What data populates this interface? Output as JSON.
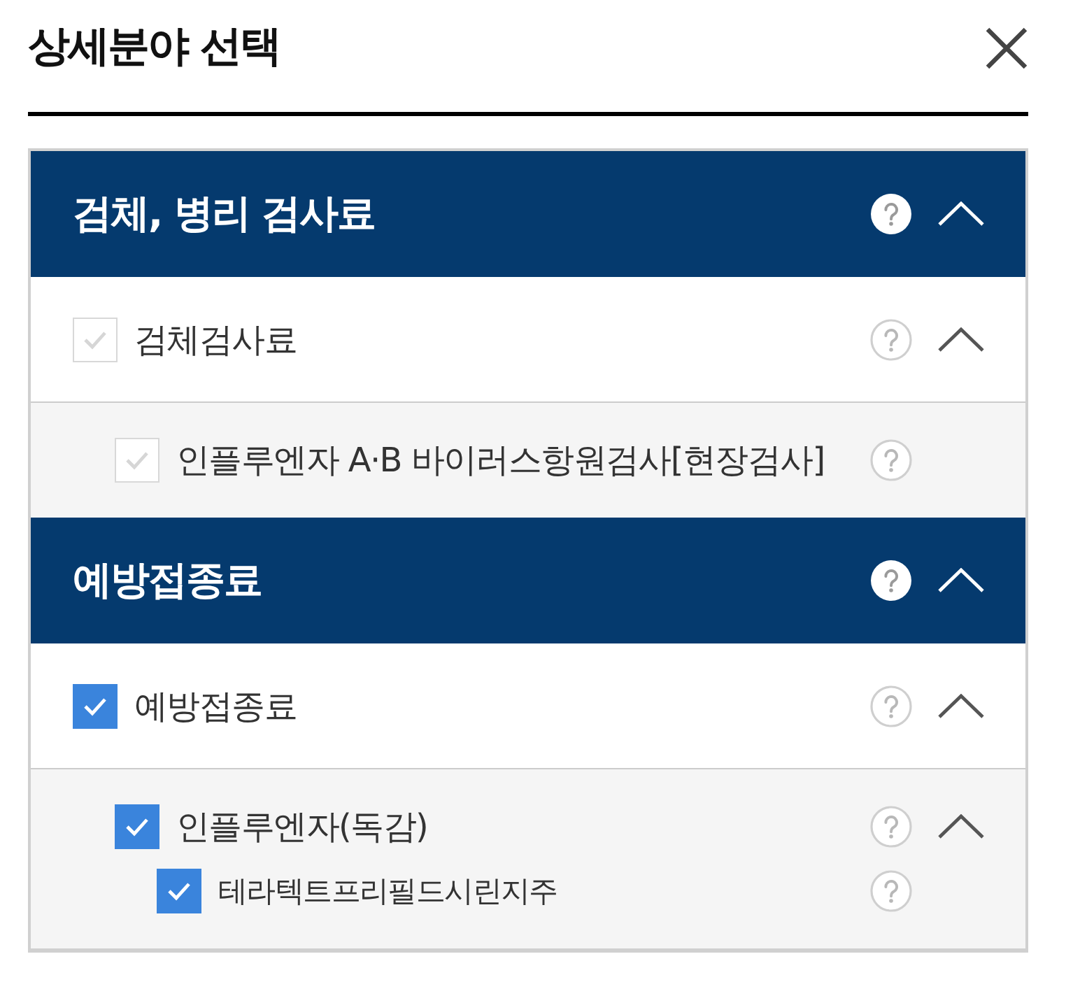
{
  "title": "상세분야 선택",
  "sections": [
    {
      "title": "검체, 병리 검사료",
      "expanded": true,
      "items": [
        {
          "label": "검체검사료",
          "checked": false,
          "expanded": true,
          "children": [
            {
              "label": "인플루엔자 A·B 바이러스항원검사[현장검사]",
              "checked": false
            }
          ]
        }
      ]
    },
    {
      "title": "예방접종료",
      "expanded": true,
      "items": [
        {
          "label": "예방접종료",
          "checked": true,
          "expanded": true,
          "children": [
            {
              "label": "인플루엔자(독감)",
              "checked": true,
              "expanded": true,
              "children": [
                {
                  "label": "테라텍트프리필드시린지주",
                  "checked": true
                }
              ]
            }
          ]
        }
      ]
    }
  ]
}
